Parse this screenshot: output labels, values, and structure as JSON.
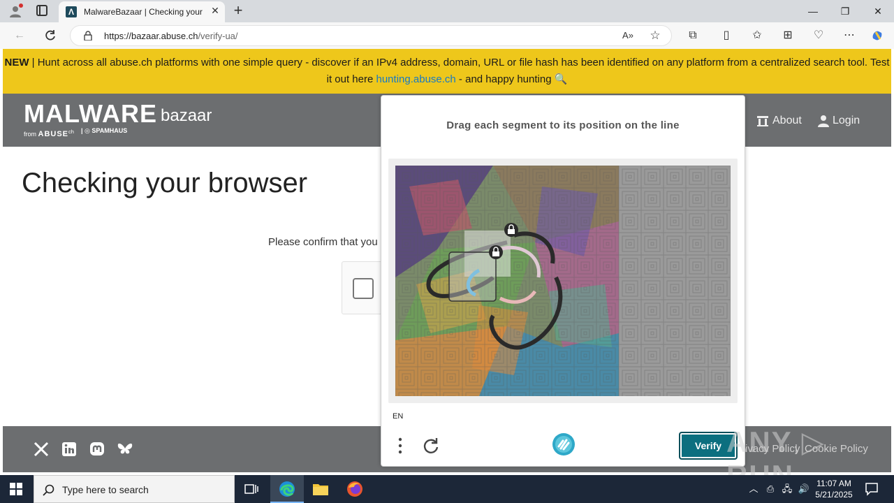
{
  "browser": {
    "tab_title": "MalwareBazaar | Checking your b",
    "url_host": "https://bazaar.abuse.ch",
    "url_path": "/verify-ua/",
    "window_minimize": "—",
    "window_maximize": "❐",
    "window_close": "✕"
  },
  "banner": {
    "new_label": "NEW",
    "text_before": " | Hunt across all abuse.ch platforms with one simple query - discover if an IPv4 address, domain, URL or file hash has been identified on any platform from a centralized search tool. Test it out here ",
    "link_text": "hunting.abuse.ch",
    "text_after": " - and happy hunting 🔍"
  },
  "site": {
    "logo_main": "MALWARE",
    "logo_sub": "bazaar",
    "logo_from": "from",
    "logo_abuse": "ABUSE",
    "logo_abuse_sup": "ch",
    "logo_spamhaus": "SPAMHAUS",
    "nav_about": "About",
    "nav_login": "Login"
  },
  "page": {
    "title": "Checking your browser",
    "confirm_text": "Please confirm that you"
  },
  "footer": {
    "privacy_link": "Privacy Policy",
    "separator": "|",
    "cookie_link": "Cookie Policy"
  },
  "captcha": {
    "prompt": "Drag each segment to its position on the line",
    "language": "EN",
    "verify_label": "Verify"
  },
  "watermark": {
    "text": "ANY ▷ RUN"
  },
  "taskbar": {
    "search_placeholder": "Type here to search",
    "clock_time": "11:07 AM",
    "clock_date": "5/21/2025"
  },
  "colors": {
    "banner": "#eec71b",
    "header": "#6c6e70",
    "verify": "#0c6f7f",
    "link": "#167ac6",
    "taskbar": "#1c2738"
  }
}
